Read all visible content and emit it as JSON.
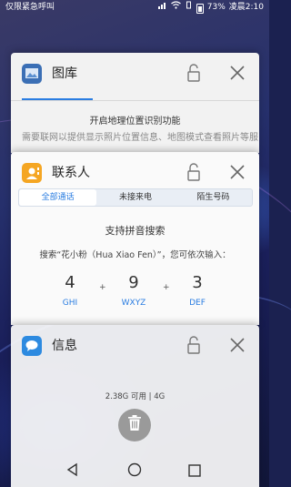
{
  "status_bar": {
    "carrier": "仅限紧急呼叫",
    "battery": "73%",
    "time": "凌晨2:10"
  },
  "cards": {
    "gallery": {
      "title": "图库",
      "line1": "开启地理位置识别功能",
      "line2": "需要联网以提供显示照片位置信息、地图模式查看照片等服"
    },
    "contacts": {
      "title": "联系人",
      "tabs": [
        "全部通话",
        "未接来电",
        "陌生号码"
      ],
      "active_tab": 0,
      "pinyin_title": "支持拼音搜索",
      "pinyin_example": "搜索“花小粉（Hua Xiao Fen）”，您可依次输入：",
      "keys": [
        {
          "digit": "4",
          "letters": "GHI"
        },
        {
          "digit": "9",
          "letters": "WXYZ"
        },
        {
          "digit": "3",
          "letters": "DEF"
        }
      ],
      "plus": "+"
    },
    "messages": {
      "title": "信息"
    }
  },
  "memory": "2.38G 可用 | 4G",
  "colors": {
    "accent": "#2a7de1",
    "gallery_icon": "#3b6fb5",
    "contacts_icon": "#f5a623",
    "messages_icon": "#2d8ae0"
  }
}
